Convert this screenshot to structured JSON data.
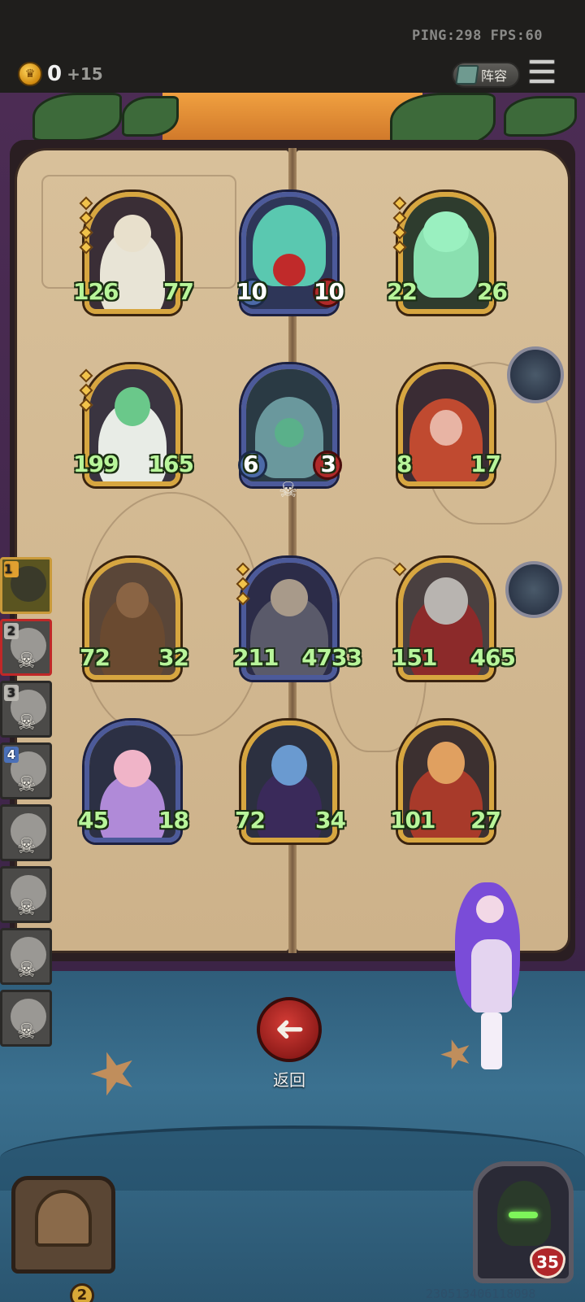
{
  "status": {
    "ping_fps": "PING:298 FPS:60"
  },
  "gold": {
    "value": "0",
    "income": "+15"
  },
  "header": {
    "lineup_label": "阵容"
  },
  "board": {
    "units": [
      {
        "atk": "126",
        "hp": "77",
        "stars": 4,
        "frame": "gold"
      },
      {
        "atk": "10",
        "hp": "10",
        "stars": 0,
        "frame": "blue",
        "white": true
      },
      {
        "atk": "22",
        "hp": "26",
        "stars": 4,
        "frame": "gold"
      },
      {
        "atk": "199",
        "hp": "165",
        "stars": 3,
        "frame": "gold"
      },
      {
        "atk": "6",
        "hp": "3",
        "stars": 0,
        "frame": "blue",
        "white": true,
        "dead": true
      },
      {
        "atk": "8",
        "hp": "17",
        "stars": 0,
        "frame": "gold"
      },
      {
        "atk": "72",
        "hp": "32",
        "stars": 0,
        "frame": "gold"
      },
      {
        "atk": "211",
        "hp": "4733",
        "stars": 3,
        "frame": "blue"
      },
      {
        "atk": "151",
        "hp": "465",
        "stars": 1,
        "frame": "gold"
      },
      {
        "atk": "45",
        "hp": "18",
        "stars": 0,
        "frame": "blue"
      },
      {
        "atk": "72",
        "hp": "34",
        "stars": 0,
        "frame": "gold"
      },
      {
        "atk": "101",
        "hp": "27",
        "stars": 0,
        "frame": "gold"
      }
    ]
  },
  "opponents": [
    {
      "rank": "1",
      "state": "active"
    },
    {
      "rank": "2",
      "state": "current"
    },
    {
      "rank": "3",
      "state": "dead"
    },
    {
      "rank": "4",
      "state": "dead"
    },
    {
      "rank": "",
      "state": "dead"
    },
    {
      "rank": "",
      "state": "dead"
    },
    {
      "rank": "",
      "state": "dead"
    },
    {
      "rank": "",
      "state": "dead"
    }
  ],
  "back_button": {
    "label": "返回"
  },
  "chest": {
    "count": "2"
  },
  "hero": {
    "hp": "35"
  },
  "build_id": "230513406118098",
  "colors": {
    "stat_text": "#b8f59a",
    "gold_frame": "#c99a3a",
    "blue_frame": "#4c5a9a",
    "back_button": "#c0302c"
  },
  "icons": {
    "coin": "crown-coin-icon",
    "menu": "hamburger-menu-icon",
    "back": "arrow-left-icon",
    "skull": "skull-icon",
    "lineup": "book-icon"
  }
}
